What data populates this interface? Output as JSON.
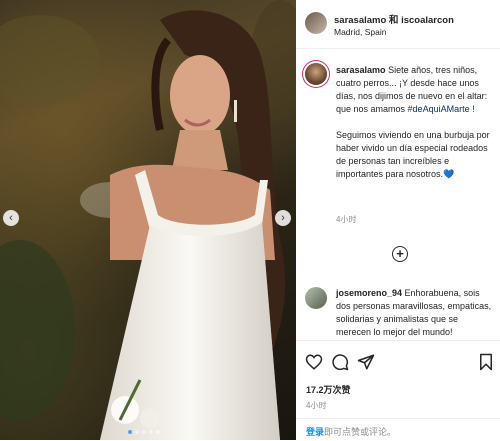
{
  "post": {
    "header": {
      "title": "sarasalamo 和 iscoalarcon",
      "location": "Madrid, Spain"
    },
    "caption": {
      "username": "sarasalamo",
      "text_part1": "Siete años, tres niños, cuatro perros... ¡Y desde hace unos días, nos dijimos de nuevo en el altar: que nos amamos ",
      "hashtag": "#deAquiAMarte",
      "text_part1_end": " !",
      "paragraph2": "Seguimos viviendo en una burbuja por haber vivido un día especial rodeados de personas tan increíbles e importantes para nosotros.",
      "emoji": "💙",
      "time": "4小时"
    },
    "comment": {
      "username": "josemoreno_94",
      "text": "Enhorabuena, sois dos personas maravillosas, empaticas, solidarias y animalistas que se merecen lo mejor del mundo!"
    },
    "likes": "17.2万次赞",
    "time": "4小时",
    "login": {
      "link": "登录",
      "rest": "即可点赞或评论。"
    },
    "carousel": {
      "slide_count": 5,
      "active_index": 0
    }
  },
  "icons": {
    "nav_prev": "chevron-left-icon",
    "nav_next": "chevron-right-icon",
    "load_more": "plus-circle-icon",
    "like": "heart-icon",
    "comment": "comment-icon",
    "share": "share-icon",
    "save": "bookmark-icon"
  },
  "colors": {
    "hashtag": "#00376b",
    "link": "#0095f6",
    "muted": "#8e8e8e",
    "story_ring": "#d62976"
  }
}
